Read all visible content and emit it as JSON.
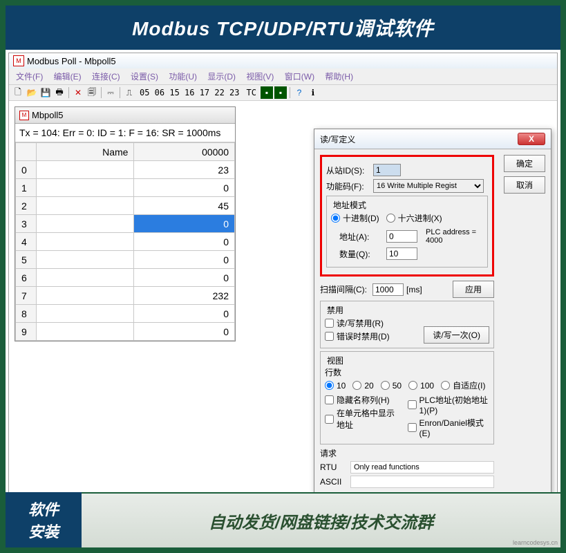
{
  "banner": {
    "title": "Modbus TCP/UDP/RTU调试软件"
  },
  "app": {
    "title": "Modbus Poll - Mbpoll5",
    "menu": [
      "文件(F)",
      "编辑(E)",
      "连接(C)",
      "设置(S)",
      "功能(U)",
      "显示(D)",
      "视图(V)",
      "窗口(W)",
      "帮助(H)"
    ],
    "toolbar_codes": "05 06 15 16 17 22 23",
    "toolbar_tc": "TC"
  },
  "child": {
    "title": "Mbpoll5",
    "status": "Tx = 104: Err = 0: ID = 1: F = 16: SR = 1000ms",
    "headers": {
      "name": "Name",
      "value": "00000"
    },
    "rows": [
      {
        "idx": "0",
        "name": "",
        "val": "23"
      },
      {
        "idx": "1",
        "name": "",
        "val": "0"
      },
      {
        "idx": "2",
        "name": "",
        "val": "45"
      },
      {
        "idx": "3",
        "name": "",
        "val": "0"
      },
      {
        "idx": "4",
        "name": "",
        "val": "0"
      },
      {
        "idx": "5",
        "name": "",
        "val": "0"
      },
      {
        "idx": "6",
        "name": "",
        "val": "0"
      },
      {
        "idx": "7",
        "name": "",
        "val": "232"
      },
      {
        "idx": "8",
        "name": "",
        "val": "0"
      },
      {
        "idx": "9",
        "name": "",
        "val": "0"
      }
    ]
  },
  "dialog": {
    "title": "读/写定义",
    "slave_label": "从站ID(S):",
    "slave_value": "1",
    "func_label": "功能码(F):",
    "func_value": "16 Write Multiple Regist",
    "addr_mode_title": "地址模式",
    "radio_dec": "十进制(D)",
    "radio_hex": "十六进制(X)",
    "addr_label": "地址(A):",
    "addr_value": "0",
    "plc_addr": "PLC address = 4000",
    "qty_label": "数量(Q):",
    "qty_value": "10",
    "scan_label": "扫描间隔(C):",
    "scan_value": "1000",
    "scan_unit": "[ms]",
    "disable_title": "禁用",
    "chk_rw_disable": "读/写禁用(R)",
    "chk_err_disable": "错误时禁用(D)",
    "view_title": "视图",
    "rows_label": "行数",
    "radio_10": "10",
    "radio_20": "20",
    "radio_50": "50",
    "radio_100": "100",
    "radio_auto": "自适应(I)",
    "chk_hide_name": "隐藏名称列(H)",
    "chk_plc_addr": "PLC地址(初始地址1)(P)",
    "chk_show_addr": "在单元格中显示地址",
    "chk_enron": "Enron/Daniel模式(E)",
    "req_title": "请求",
    "rtu_label": "RTU",
    "rtu_value": "Only read functions",
    "ascii_label": "ASCII",
    "ascii_value": "",
    "btn_ok": "确定",
    "btn_cancel": "取消",
    "btn_apply": "应用",
    "btn_once": "读/写一次(O)"
  },
  "footer": {
    "left1": "软件",
    "left2": "安装",
    "right": "自动发货/网盘链接/技术交流群",
    "watermark": "learncodesys.cn"
  }
}
